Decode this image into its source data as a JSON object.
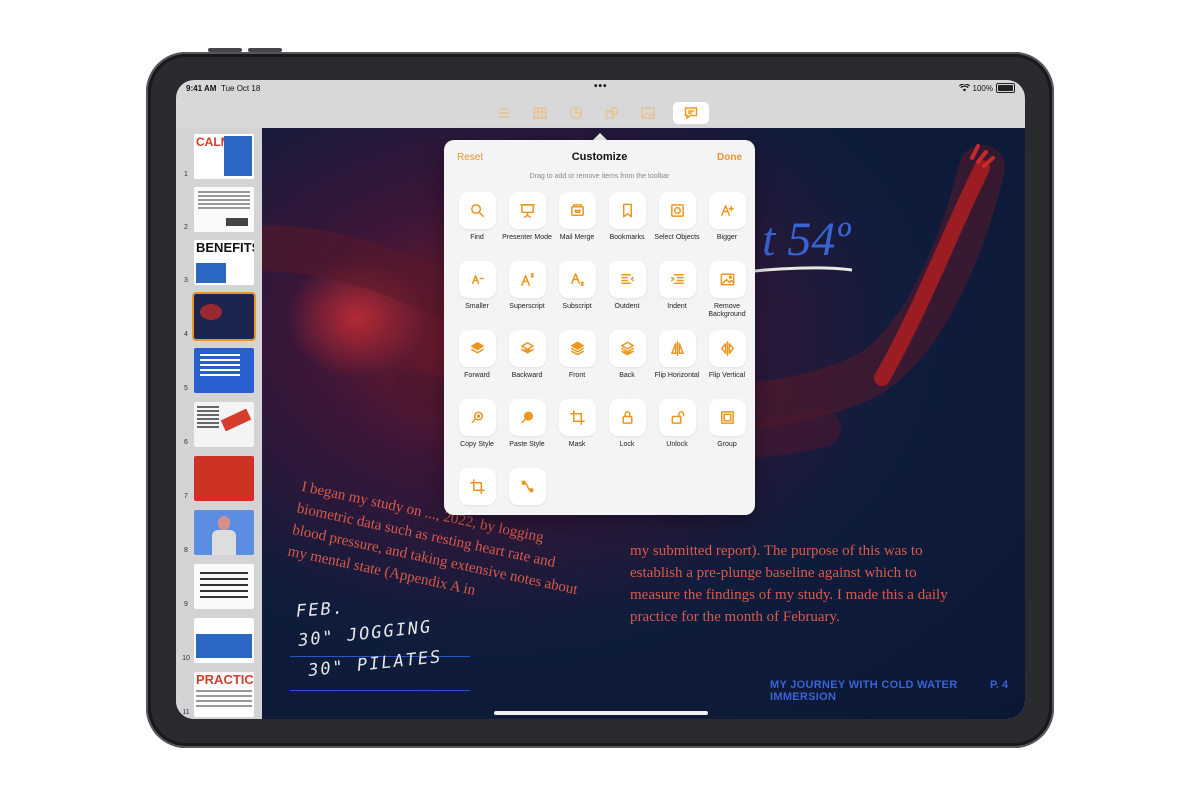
{
  "status_bar": {
    "time": "9:41 AM",
    "date": "Tue Oct 18",
    "battery": "100%"
  },
  "toolbar": {
    "icons": [
      "list-icon",
      "table-icon",
      "chart-icon",
      "shape-icon",
      "media-icon",
      "comment-icon"
    ],
    "active": "comment-icon"
  },
  "sidebar": {
    "slides": [
      {
        "num": "1",
        "title": "CALM"
      },
      {
        "num": "2",
        "title": ""
      },
      {
        "num": "3",
        "title": "BENEFITS"
      },
      {
        "num": "4",
        "title": ""
      },
      {
        "num": "5",
        "title": ""
      },
      {
        "num": "6",
        "title": ""
      },
      {
        "num": "7",
        "title": ""
      },
      {
        "num": "8",
        "title": ""
      },
      {
        "num": "9",
        "title": ""
      },
      {
        "num": "10",
        "title": ""
      },
      {
        "num": "11",
        "title": "PRACTICE"
      }
    ],
    "selected": "4"
  },
  "popover": {
    "reset": "Reset",
    "title": "Customize",
    "done": "Done",
    "subtitle": "Drag to add or remove items from the toolbar",
    "items": [
      {
        "label": "Find",
        "icon": "search-icon"
      },
      {
        "label": "Presenter Mode",
        "icon": "presenter-icon"
      },
      {
        "label": "Mail Merge",
        "icon": "mail-merge-icon"
      },
      {
        "label": "Bookmarks",
        "icon": "bookmark-icon"
      },
      {
        "label": "Select Objects",
        "icon": "select-objects-icon"
      },
      {
        "label": "Bigger",
        "icon": "bigger-text-icon"
      },
      {
        "label": "Smaller",
        "icon": "smaller-text-icon"
      },
      {
        "label": "Superscript",
        "icon": "superscript-icon"
      },
      {
        "label": "Subscript",
        "icon": "subscript-icon"
      },
      {
        "label": "Outdent",
        "icon": "outdent-icon"
      },
      {
        "label": "Indent",
        "icon": "indent-icon"
      },
      {
        "label": "Remove Background",
        "icon": "remove-background-icon"
      },
      {
        "label": "Forward",
        "icon": "forward-icon"
      },
      {
        "label": "Backward",
        "icon": "backward-icon"
      },
      {
        "label": "Front",
        "icon": "front-icon"
      },
      {
        "label": "Back",
        "icon": "back-icon"
      },
      {
        "label": "Flip Horizontal",
        "icon": "flip-horizontal-icon"
      },
      {
        "label": "Flip Vertical",
        "icon": "flip-vertical-icon"
      },
      {
        "label": "Copy Style",
        "icon": "copy-style-icon"
      },
      {
        "label": "Paste Style",
        "icon": "paste-style-icon"
      },
      {
        "label": "Mask",
        "icon": "mask-icon"
      },
      {
        "label": "Lock",
        "icon": "lock-icon"
      },
      {
        "label": "Unlock",
        "icon": "unlock-icon"
      },
      {
        "label": "Group",
        "icon": "group-icon"
      },
      {
        "label": "",
        "icon": "crop-icon"
      },
      {
        "label": "",
        "icon": "path-icon"
      }
    ]
  },
  "slide": {
    "big_number": "t 54º",
    "body_left": "I began my study on ..., 2022, by logging biometric data such as resting heart rate and blood pressure, and taking extensive notes about my mental state (Appendix A in",
    "body_right": "my submitted report). The purpose of this was to establish a pre-plunge baseline against which to measure the findings of my study. I made this a daily practice for the month of February.",
    "hand_line1": "FEB.",
    "hand_line2": "30\" JOGGING",
    "hand_line3": "30\" PILATES",
    "footer_title": "MY JOURNEY WITH COLD WATER IMMERSION",
    "footer_page": "P. 4"
  }
}
